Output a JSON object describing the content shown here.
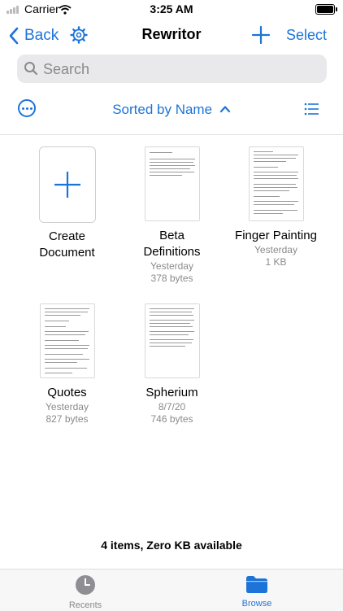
{
  "status_bar": {
    "carrier": "Carrier",
    "time": "3:25 AM"
  },
  "nav": {
    "back_label": "Back",
    "title": "Rewritor",
    "select_label": "Select"
  },
  "search": {
    "placeholder": "Search"
  },
  "sort": {
    "label": "Sorted by Name"
  },
  "documents": [
    {
      "name_line1": "Create",
      "name_line2": "Document"
    },
    {
      "name_line1": "Beta",
      "name_line2": "Definitions",
      "date": "Yesterday",
      "size": "378 bytes"
    },
    {
      "name_line1": "Finger Painting",
      "date": "Yesterday",
      "size": "1 KB"
    },
    {
      "name_line1": "Quotes",
      "date": "Yesterday",
      "size": "827 bytes"
    },
    {
      "name_line1": "Spherium",
      "date": "8/7/20",
      "size": "746 bytes"
    }
  ],
  "footer": {
    "summary": "4 items, Zero KB available"
  },
  "tabs": [
    {
      "label": "Recents"
    },
    {
      "label": "Browse"
    }
  ],
  "colors": {
    "accent": "#1d74d8",
    "secondary_text": "#8a8a8e",
    "search_bg": "#e9e9eb"
  }
}
